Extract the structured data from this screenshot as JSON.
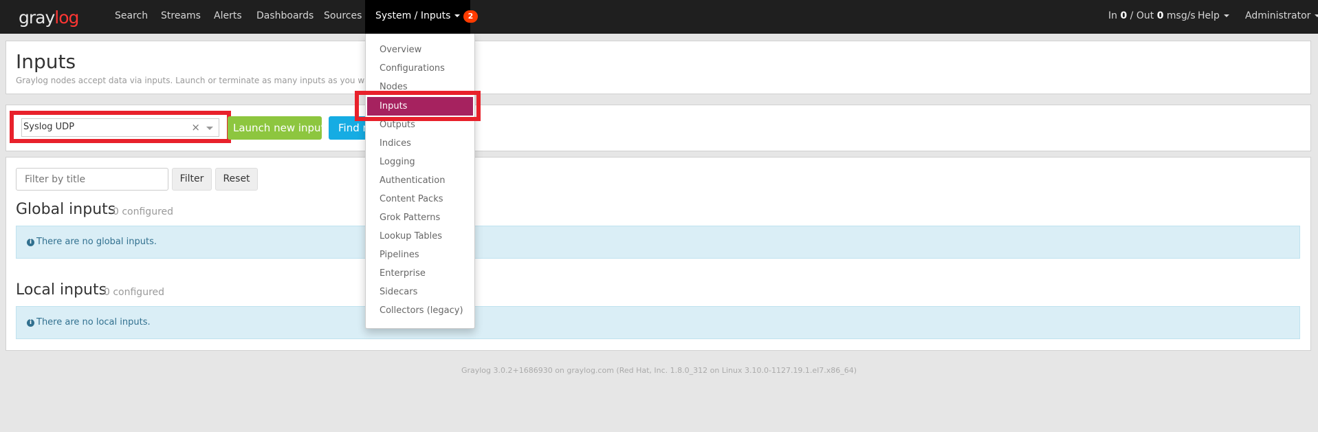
{
  "navbar": {
    "logo_main": "gray",
    "logo_accent": "log",
    "items": [
      {
        "label": "Search"
      },
      {
        "label": "Streams"
      },
      {
        "label": "Alerts"
      },
      {
        "label": "Dashboards"
      },
      {
        "label": "Sources"
      },
      {
        "label": "System / Inputs"
      }
    ],
    "notification_count": "2",
    "throughput": {
      "in_label": "In",
      "in_value": "0",
      "sep": "/ Out",
      "out_value": "0",
      "unit": "msg/s"
    },
    "help_label": "Help",
    "user_label": "Administrator"
  },
  "page": {
    "title": "Inputs",
    "description": "Graylog nodes accept data via inputs. Launch or terminate as many inputs as you want here."
  },
  "launch": {
    "selected_input_type": "Syslog UDP",
    "clear_symbol": "×",
    "launch_button": "Launch new input",
    "find_button": "Find more inputs"
  },
  "filter": {
    "placeholder": "Filter by title",
    "filter_button": "Filter",
    "reset_button": "Reset"
  },
  "global_inputs": {
    "title": "Global inputs",
    "count": "0 configured",
    "empty_message": "There are no global inputs."
  },
  "local_inputs": {
    "title": "Local inputs",
    "count": "0 configured",
    "empty_message": "There are no local inputs."
  },
  "system_menu": {
    "items": [
      {
        "label": "Overview"
      },
      {
        "label": "Configurations"
      },
      {
        "label": "Nodes"
      },
      {
        "label": "Inputs",
        "active": true
      },
      {
        "label": "Outputs"
      },
      {
        "label": "Indices"
      },
      {
        "label": "Logging"
      },
      {
        "label": "Authentication"
      },
      {
        "label": "Content Packs"
      },
      {
        "label": "Grok Patterns"
      },
      {
        "label": "Lookup Tables"
      },
      {
        "label": "Pipelines"
      },
      {
        "label": "Enterprise"
      },
      {
        "label": "Sidecars"
      },
      {
        "label": "Collectors (legacy)"
      }
    ]
  },
  "footer": {
    "text": "Graylog 3.0.2+1686930 on graylog.com (Red Hat, Inc. 1.8.0_312 on Linux 3.10.0-1127.19.1.el7.x86_64)"
  },
  "colors": {
    "navbar_bg": "#1f1f1f",
    "active_menu": "#a6225f",
    "launch_green": "#8dc63f",
    "find_blue": "#16ace3",
    "badge_red": "#ff3b00",
    "highlight_red": "#e8212b",
    "info_bg": "#daeef6"
  }
}
